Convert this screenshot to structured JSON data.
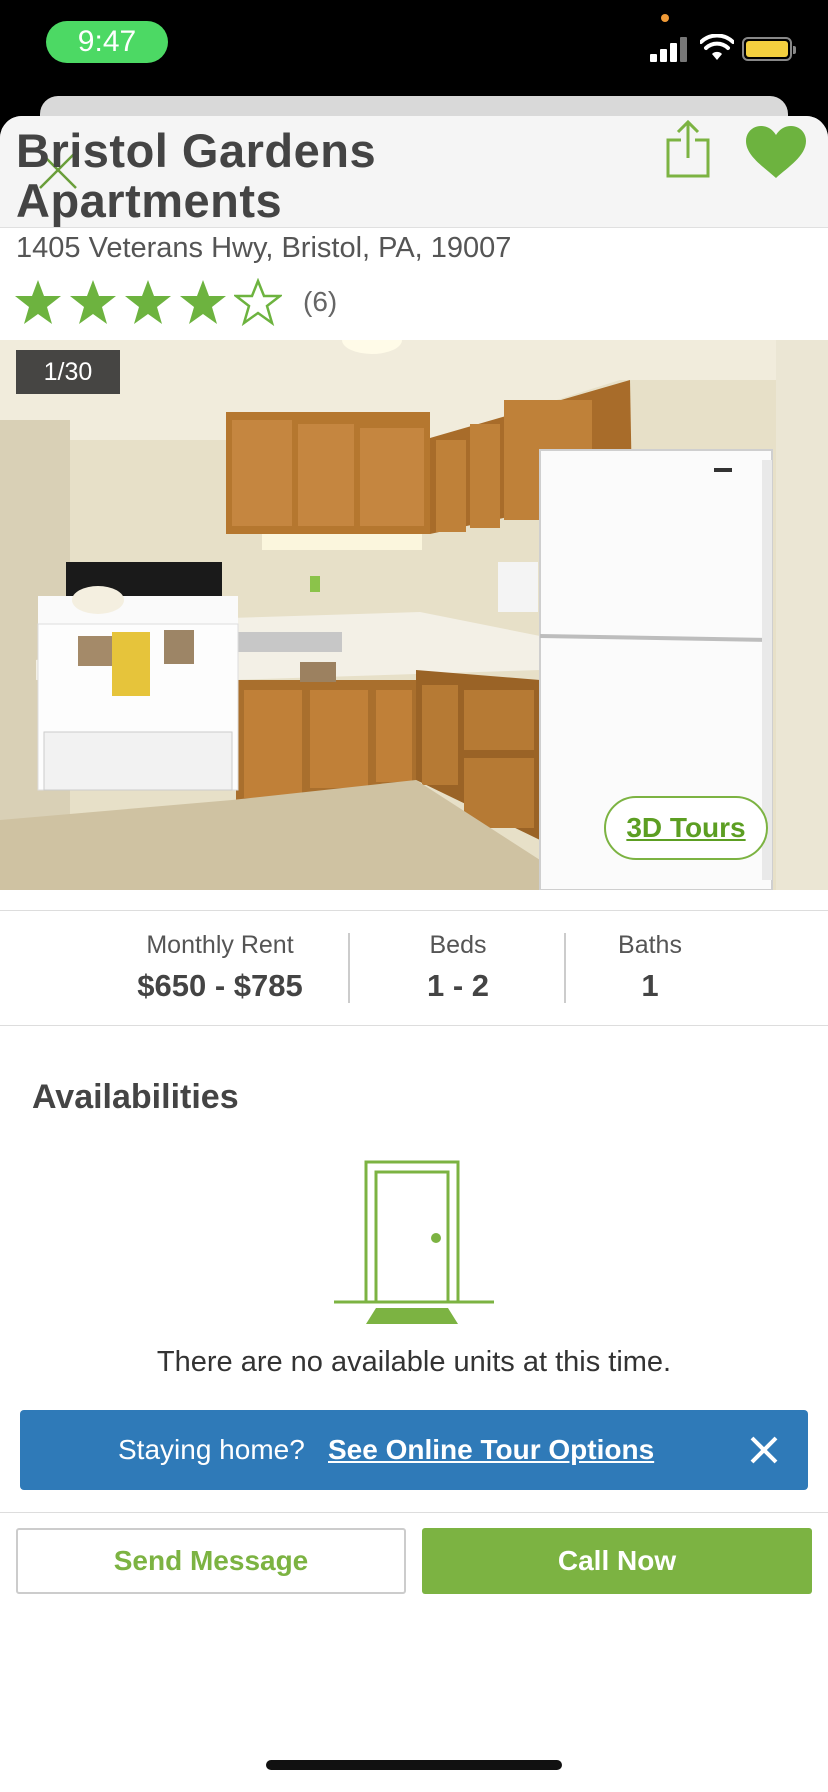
{
  "status_bar": {
    "time": "9:47"
  },
  "listing": {
    "title": "Bristol Gardens Apartments",
    "address": "1405 Veterans Hwy, Bristol, PA, 19007",
    "rating": 4,
    "max_rating": 5,
    "review_count": "(6)"
  },
  "photo": {
    "counter": "1/30",
    "tours_label": "3D Tours"
  },
  "stats": [
    {
      "label": "Monthly Rent",
      "value": "$650 - $785"
    },
    {
      "label": "Beds",
      "value": "1 - 2"
    },
    {
      "label": "Baths",
      "value": "1"
    }
  ],
  "availabilities": {
    "title": "Availabilities",
    "empty_message": "There are no available units at this time."
  },
  "banner": {
    "text": "Staying home?",
    "link": "See Online Tour Options"
  },
  "actions": {
    "send_message": "Send Message",
    "call_now": "Call Now"
  },
  "colors": {
    "brand_green": "#7cb342",
    "banner_blue": "#2f7ab8",
    "time_pill": "#4cd964"
  }
}
